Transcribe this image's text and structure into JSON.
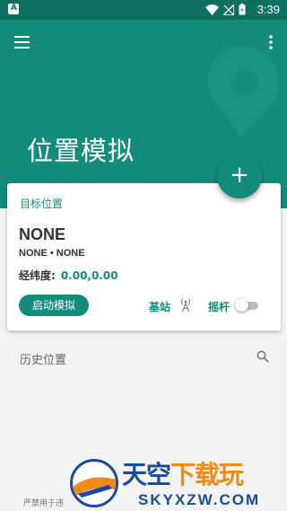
{
  "status_bar": {
    "app_badge": "A",
    "time": "3:39"
  },
  "app_bar": {
    "title": "位置模拟"
  },
  "fab": {
    "label": "+"
  },
  "target_card": {
    "label": "目标位置",
    "name": "NONE",
    "subtitle": "NONE • NONE",
    "coord_label": "经纬度:",
    "coord_value": "0.00,0.00",
    "start_button": "启动模拟",
    "station_label": "基站",
    "joystick_label": "摇杆",
    "joystick_enabled": false
  },
  "history": {
    "label": "历史位置"
  },
  "footer": {
    "note": "严禁用于违"
  },
  "watermark": {
    "title_a": "天空",
    "title_b": "下载玩",
    "subtitle": "SKYXZW.COM"
  },
  "colors": {
    "primary": "#148c7b",
    "status_bar": "#0e6e60",
    "background": "#f3f3f3"
  },
  "icons": [
    "menu-icon",
    "more-vert-icon",
    "wifi-icon",
    "signal-icon",
    "battery-icon",
    "add-icon",
    "antenna-icon",
    "search-icon"
  ]
}
